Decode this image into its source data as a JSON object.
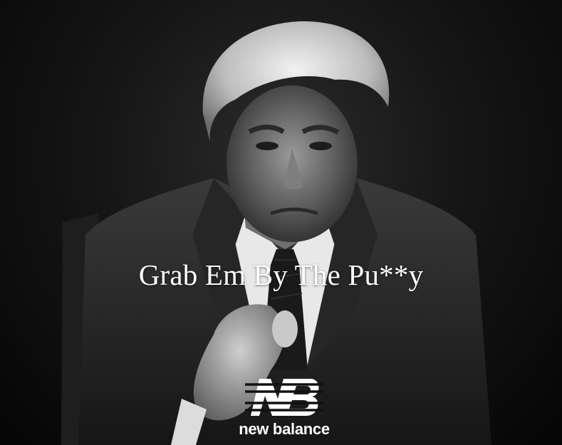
{
  "caption": "Grab Em By The Pu**y",
  "brand": {
    "wordmark": "new balance",
    "logo_icon": "nb-logo-icon"
  },
  "colors": {
    "background": "#121212",
    "text": "#ffffff"
  }
}
